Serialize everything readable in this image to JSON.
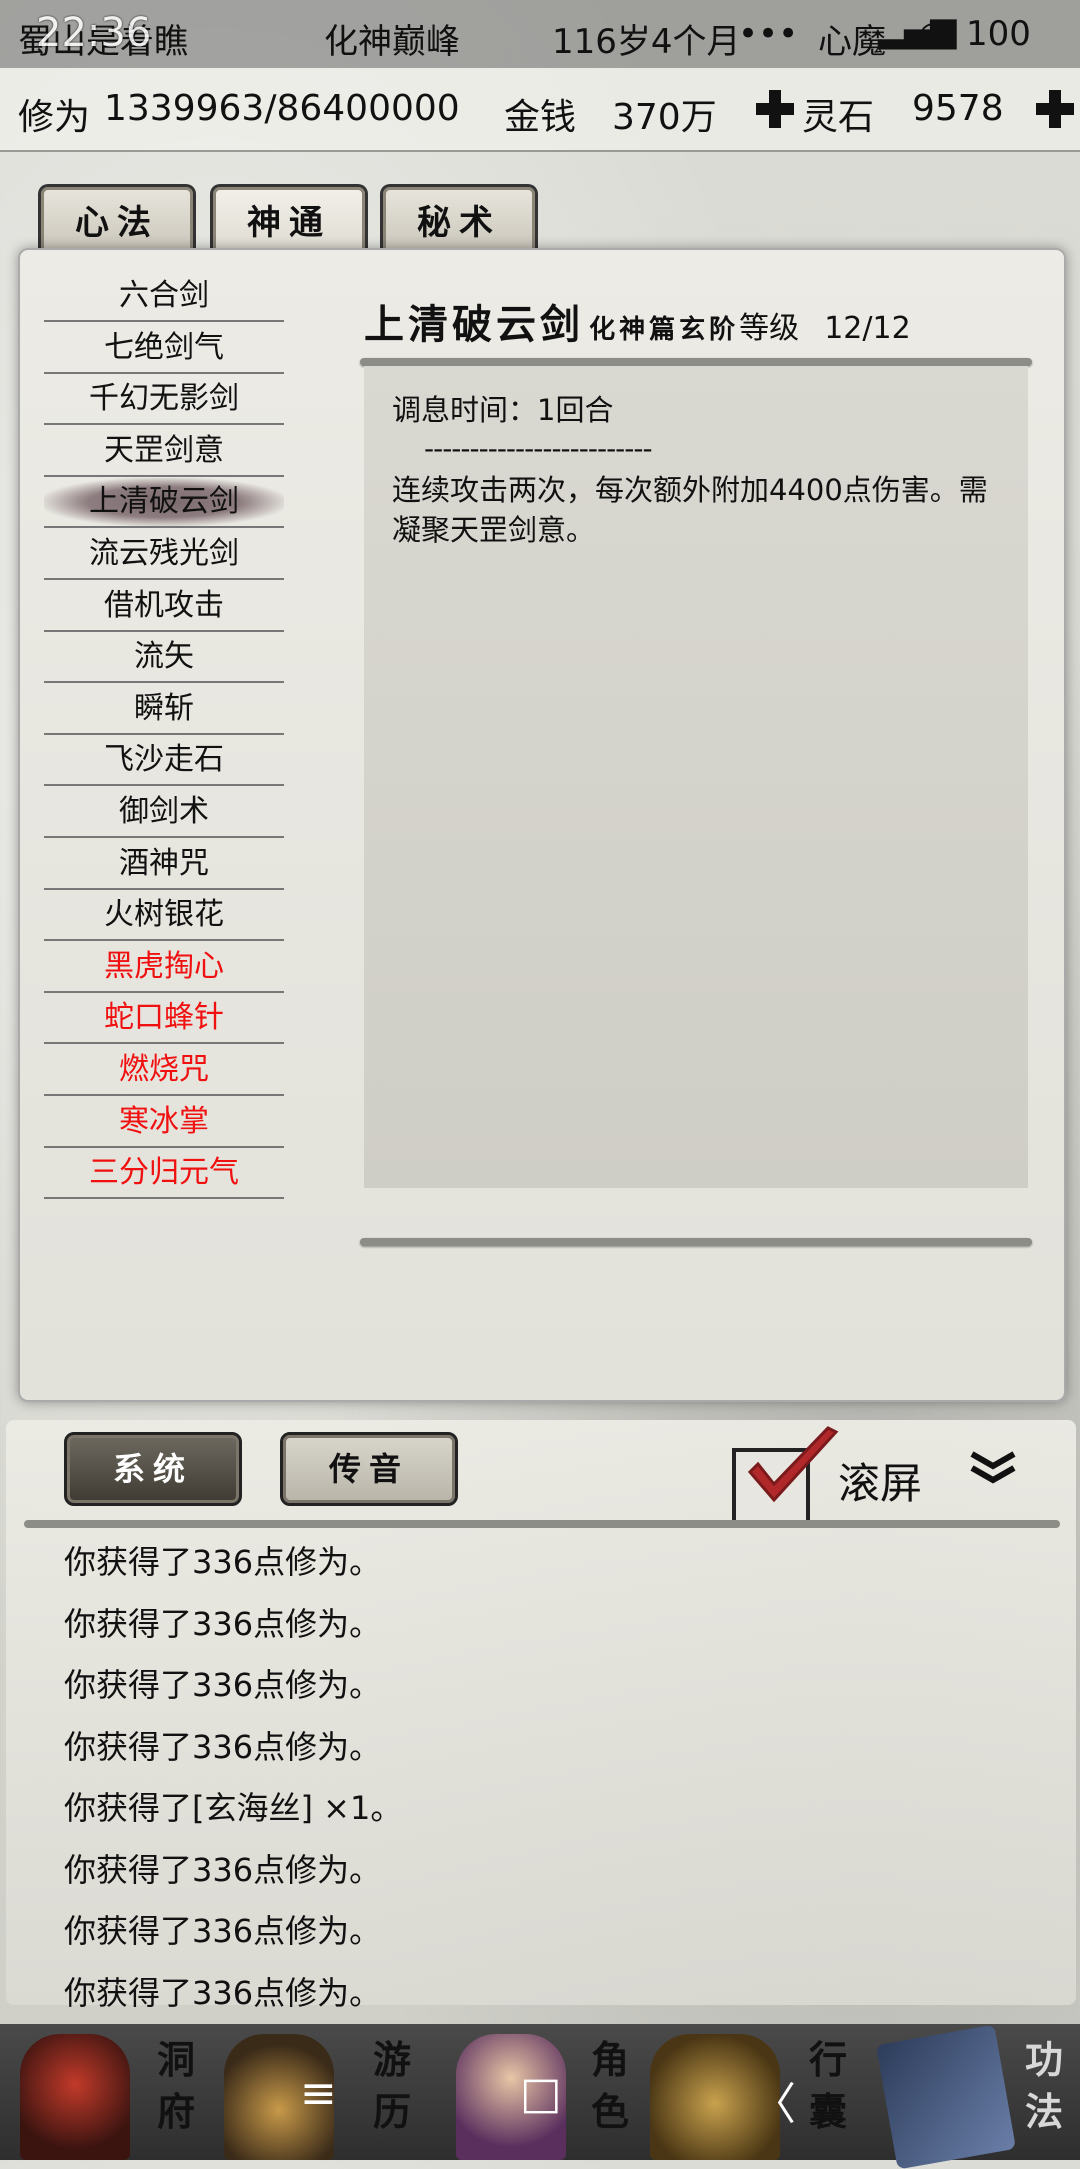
{
  "status": {
    "clock": "22:36",
    "location": "蜀山是着瞧",
    "realm": "化神巅峰",
    "age": "116岁4个月",
    "signal_text": "心魔",
    "battery": "100"
  },
  "stats": {
    "cultivation_label": "修为",
    "cultivation_value": "1339963/86400000",
    "money_label": "金钱",
    "money_value": "370万",
    "stone_label": "灵石",
    "stone_value": "9578"
  },
  "tabs": [
    "心法",
    "神通",
    "秘术"
  ],
  "active_tab": 1,
  "skills": [
    {
      "name": "六合剑",
      "red": false
    },
    {
      "name": "七绝剑气",
      "red": false
    },
    {
      "name": "千幻无影剑",
      "red": false
    },
    {
      "name": "天罡剑意",
      "red": false
    },
    {
      "name": "上清破云剑",
      "red": false,
      "selected": true
    },
    {
      "name": "流云残光剑",
      "red": false
    },
    {
      "name": "借机攻击",
      "red": false
    },
    {
      "name": "流矢",
      "red": false
    },
    {
      "name": "瞬斩",
      "red": false
    },
    {
      "name": "飞沙走石",
      "red": false
    },
    {
      "name": "御剑术",
      "red": false
    },
    {
      "name": "酒神咒",
      "red": false
    },
    {
      "name": "火树银花",
      "red": false
    },
    {
      "name": "黑虎掏心",
      "red": true
    },
    {
      "name": "蛇口蜂针",
      "red": true
    },
    {
      "name": "燃烧咒",
      "red": true
    },
    {
      "name": "寒冰掌",
      "red": true
    },
    {
      "name": "三分归元气",
      "red": true
    }
  ],
  "detail": {
    "name": "上清破云剑",
    "tier": "化神篇玄阶",
    "level_label": "等级",
    "level_value": "12/12",
    "cooldown": "调息时间：1回合",
    "separator": "-------------------------",
    "description": "连续攻击两次，每次额外附加4400点伤害。需凝聚天罡剑意。"
  },
  "log": {
    "tab_system": "系统",
    "tab_message": "传音",
    "scroll_label": "滚屏",
    "scroll_checked": true,
    "lines": [
      "你获得了336点修为。",
      "你获得了336点修为。",
      "你获得了336点修为。",
      "你获得了336点修为。",
      "你获得了[玄海丝] ×1。",
      "你获得了336点修为。",
      "你获得了336点修为。",
      "你获得了336点修为。"
    ]
  },
  "nav": [
    {
      "label": "洞府",
      "icon": "cave-dwelling-icon"
    },
    {
      "label": "游历",
      "icon": "travel-icon"
    },
    {
      "label": "角色",
      "icon": "character-icon"
    },
    {
      "label": "行囊",
      "icon": "bag-icon"
    },
    {
      "label": "功法",
      "icon": "books-icon"
    }
  ],
  "system_nav": {
    "menu": "≡",
    "home": "□",
    "back": "〈"
  }
}
